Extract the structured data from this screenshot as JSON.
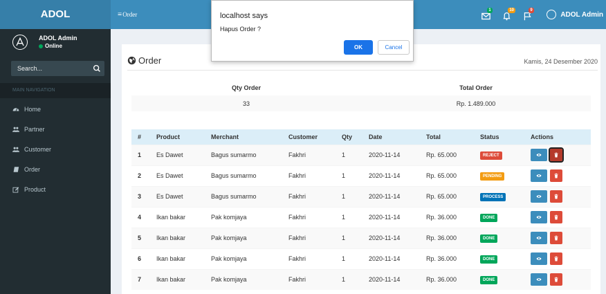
{
  "header": {
    "logo": "ADOL",
    "toggle_label": "Order",
    "badges": {
      "messages": "1",
      "notifications": "10",
      "tasks": "9"
    },
    "user_name": "ADOL Admin"
  },
  "sidebar": {
    "user_name": "ADOL Admin",
    "status": "Online",
    "search_placeholder": "Search...",
    "nav_header": "MAIN NAVIGATION",
    "items": [
      {
        "label": "Home",
        "icon": "dashboard-icon"
      },
      {
        "label": "Partner",
        "icon": "users-icon"
      },
      {
        "label": "Customer",
        "icon": "users-icon"
      },
      {
        "label": "Order",
        "icon": "book-icon"
      },
      {
        "label": "Product",
        "icon": "edit-icon"
      }
    ]
  },
  "main": {
    "title": "Order",
    "date": "Kamis, 24 Desember 2020",
    "summary": {
      "qty_label": "Qty Order",
      "total_label": "Total Order",
      "qty_value": "33",
      "total_value": "Rp. 1.489.000"
    },
    "table": {
      "columns": [
        "#",
        "Product",
        "Merchant",
        "Customer",
        "Qty",
        "Date",
        "Total",
        "Status",
        "Actions"
      ],
      "rows": [
        {
          "no": "1",
          "product": "Es Dawet",
          "merchant": "Bagus sumarmo",
          "customer": "Fakhri",
          "qty": "1",
          "date": "2020-11-14",
          "total": "Rp. 65.000",
          "status": "REJECT"
        },
        {
          "no": "2",
          "product": "Es Dawet",
          "merchant": "Bagus sumarmo",
          "customer": "Fakhri",
          "qty": "1",
          "date": "2020-11-14",
          "total": "Rp. 65.000",
          "status": "PENDING"
        },
        {
          "no": "3",
          "product": "Es Dawet",
          "merchant": "Bagus sumarmo",
          "customer": "Fakhri",
          "qty": "1",
          "date": "2020-11-14",
          "total": "Rp. 65.000",
          "status": "PROCESS"
        },
        {
          "no": "4",
          "product": "Ikan bakar",
          "merchant": "Pak komjaya",
          "customer": "Fakhri",
          "qty": "1",
          "date": "2020-11-14",
          "total": "Rp. 36.000",
          "status": "DONE"
        },
        {
          "no": "5",
          "product": "Ikan bakar",
          "merchant": "Pak komjaya",
          "customer": "Fakhri",
          "qty": "1",
          "date": "2020-11-14",
          "total": "Rp. 36.000",
          "status": "DONE"
        },
        {
          "no": "6",
          "product": "Ikan bakar",
          "merchant": "Pak komjaya",
          "customer": "Fakhri",
          "qty": "1",
          "date": "2020-11-14",
          "total": "Rp. 36.000",
          "status": "DONE"
        },
        {
          "no": "7",
          "product": "Ikan bakar",
          "merchant": "Pak komjaya",
          "customer": "Fakhri",
          "qty": "1",
          "date": "2020-11-14",
          "total": "Rp. 36.000",
          "status": "DONE"
        }
      ]
    }
  },
  "dialog": {
    "title": "localhost says",
    "message": "Hapus Order ?",
    "ok_label": "OK",
    "cancel_label": "Cancel"
  },
  "colors": {
    "header": "#3c8dbc",
    "logo_bg": "#367fa9",
    "sidebar": "#222d32",
    "reject": "#dd4b39",
    "pending": "#f39c12",
    "process": "#0073b7",
    "done": "#00a65a"
  }
}
